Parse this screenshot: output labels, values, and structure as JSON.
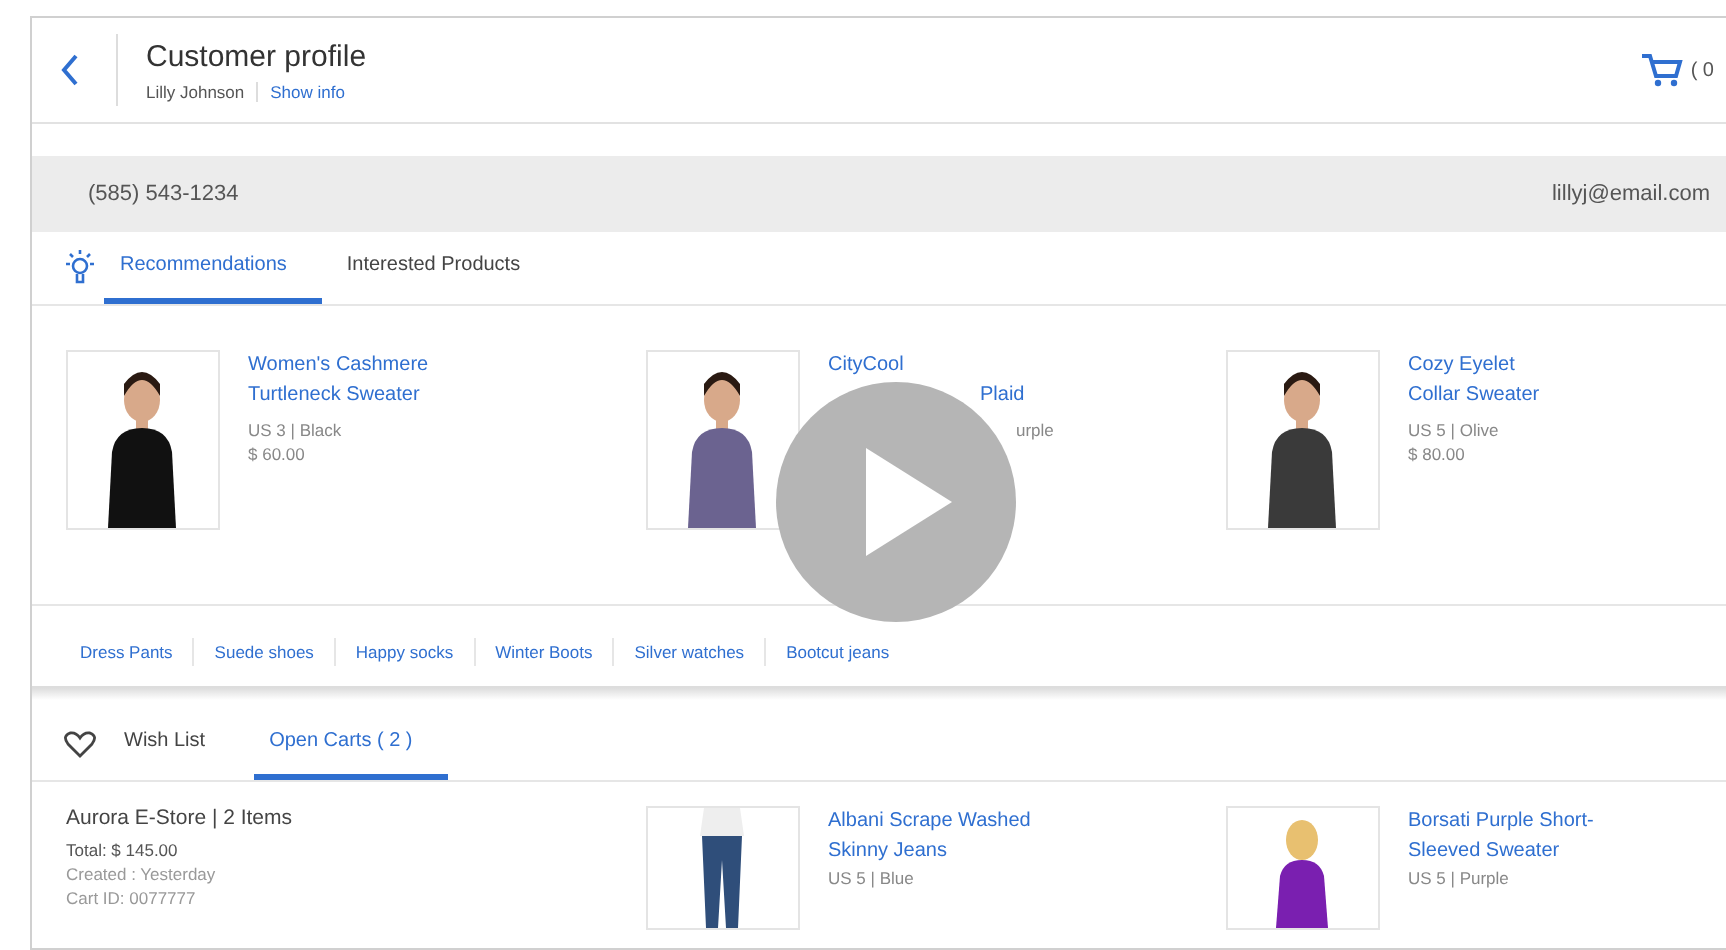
{
  "header": {
    "title": "Customer profile",
    "customer": "Lilly Johnson",
    "link": "Show info",
    "cart_count": "( 0"
  },
  "contact": {
    "phone": "(585) 543-1234",
    "email": "lillyj@email.com"
  },
  "tabs": [
    {
      "label": "Recommendations",
      "selected": true
    },
    {
      "label": "Interested Products",
      "selected": false
    }
  ],
  "products": [
    {
      "title": [
        "Women's Cashmere",
        "Turtleneck Sweater"
      ],
      "meta": [
        "US 3  |  Black",
        "$ 60.00"
      ]
    },
    {
      "title": [
        "CityCool",
        "Plaid"
      ],
      "meta": [
        "urple"
      ]
    },
    {
      "title": [
        "Cozy Eyelet",
        "Collar Sweater"
      ],
      "meta": [
        "US 5  |  Olive",
        "$ 80.00"
      ]
    }
  ],
  "searches": [
    "Dress Pants",
    "Suede shoes",
    "Happy socks",
    "Winter Boots",
    "Silver watches",
    "Bootcut jeans"
  ],
  "list_tabs": [
    {
      "label": "Wish List",
      "selected": false
    },
    {
      "label": "Open Carts ( 2 )",
      "selected": true
    }
  ],
  "cart": {
    "store": "Aurora E-Store  |  2 Items",
    "lines": [
      "Total: $ 145.00",
      "Created : Yesterday",
      "Cart ID: 0077777"
    ]
  },
  "cart_items": [
    {
      "title": [
        "Albani Scrape Washed",
        "Skinny Jeans"
      ],
      "meta": "US 5  |  Blue"
    },
    {
      "title": [
        "Borsati Purple Short-",
        "Sleeved Sweater"
      ],
      "meta": "US 5 | Purple"
    }
  ]
}
